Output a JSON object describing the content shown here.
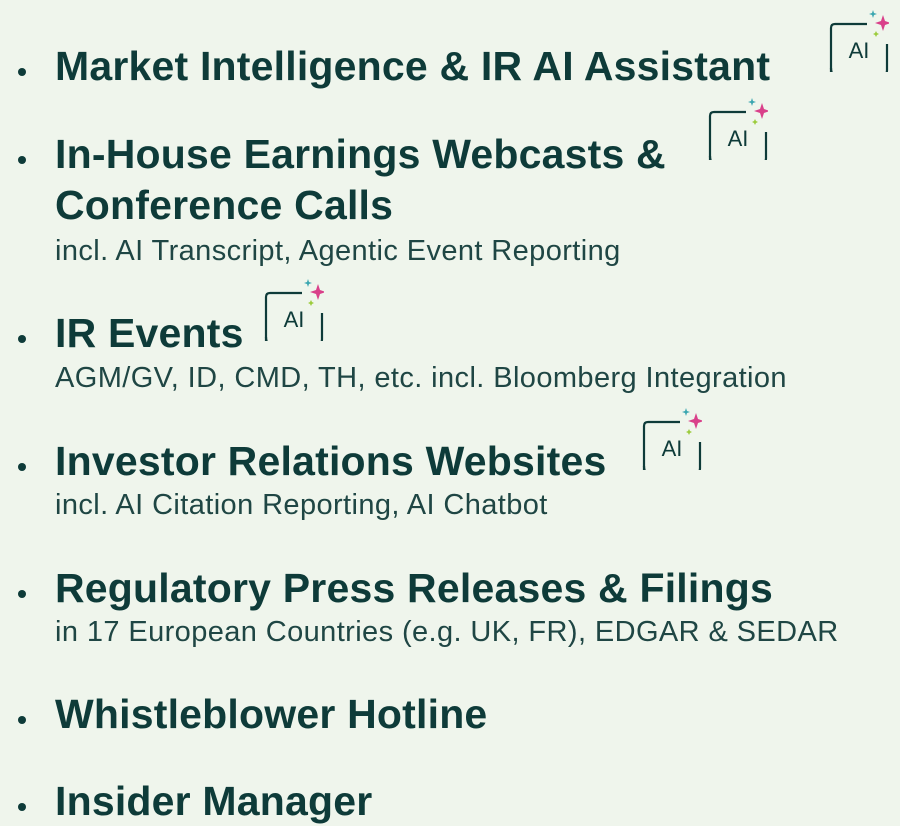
{
  "items": [
    {
      "title": "Market Intelligence &  IR AI Assistant",
      "subtitle": "",
      "ai_badge": true
    },
    {
      "title_line1": "In-House Earnings Webcasts &",
      "title_line2": "Conference Calls",
      "subtitle": "incl. AI Transcript, Agentic Event Reporting",
      "ai_badge": true
    },
    {
      "title": "IR Events",
      "subtitle": "AGM/GV, ID, CMD, TH, etc. incl. Bloomberg Integration",
      "ai_badge": true
    },
    {
      "title": "Investor Relations Websites",
      "subtitle": "incl. AI Citation Reporting, AI Chatbot",
      "ai_badge": true
    },
    {
      "title": "Regulatory Press Releases & Filings",
      "subtitle": "in 17 European Countries (e.g. UK, FR), EDGAR & SEDAR",
      "ai_badge": false
    },
    {
      "title": "Whistleblower Hotline",
      "subtitle": "",
      "ai_badge": false
    },
    {
      "title": "Insider Manager",
      "subtitle": "",
      "ai_badge": false
    }
  ],
  "badge": {
    "label": "AI",
    "icon": "ai-sparkle-icon",
    "colors": {
      "frame": "#0e3b39",
      "sparkle_large": "#d9408a",
      "sparkle_small": "#3aa6b0",
      "sparkle_tiny": "#9ccc3d"
    }
  },
  "colors": {
    "background": "#eff5ec",
    "text": "#0e3b39"
  }
}
